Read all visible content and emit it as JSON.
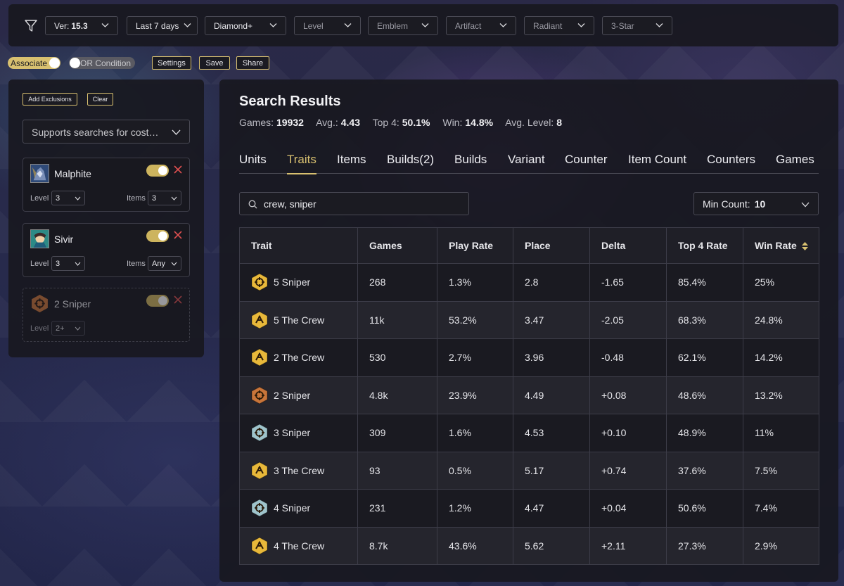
{
  "filters": {
    "version_prefix": "Ver:",
    "version": "15.3",
    "period": "Last 7 days",
    "rank": "Diamond+",
    "level": "Level",
    "emblem": "Emblem",
    "artifact": "Artifact",
    "radiant": "Radiant",
    "three_star": "3-Star"
  },
  "options": {
    "associate": "Associate",
    "or_condition": "OR Condition",
    "settings": "Settings",
    "save": "Save",
    "share": "Share"
  },
  "left": {
    "add_exclusions": "Add Exclusions",
    "clear": "Clear",
    "search_placeholder": "Supports searches for cost…",
    "cards": [
      {
        "name": "Malphite",
        "level_label": "Level",
        "level": "3",
        "items_label": "Items",
        "items": "3"
      },
      {
        "name": "Sivir",
        "level_label": "Level",
        "level": "3",
        "items_label": "Items",
        "items": "Any"
      },
      {
        "name": "2 Sniper",
        "level_label": "Level",
        "level": "2+"
      }
    ]
  },
  "main": {
    "title": "Search Results",
    "stats": {
      "games_label": "Games:",
      "games": "19932",
      "avg_label": "Avg.:",
      "avg": "4.43",
      "top4_label": "Top 4:",
      "top4": "50.1%",
      "win_label": "Win:",
      "win": "14.8%",
      "avg_level_label": "Avg. Level:",
      "avg_level": "8"
    },
    "tabs": [
      "Units",
      "Traits",
      "Items",
      "Builds(2)",
      "Builds",
      "Variant",
      "Counter",
      "Item Count",
      "Counters",
      "Games"
    ],
    "active_tab": "Traits",
    "search_value": "crew, sniper",
    "min_count_label": "Min Count:",
    "min_count": "10"
  },
  "table": {
    "headers": [
      "Trait",
      "Games",
      "Play Rate",
      "Place",
      "Delta",
      "Top 4 Rate",
      "Win Rate"
    ],
    "rows": [
      {
        "trait": "5 Sniper",
        "icon": "sniper-gold-icon",
        "tier": "gold",
        "games": "268",
        "play_rate": "1.3%",
        "place": "2.8",
        "delta": "-1.65",
        "top4": "85.4%",
        "win": "25%"
      },
      {
        "trait": "5 The Crew",
        "icon": "crew-gold-icon",
        "tier": "gold",
        "games": "11k",
        "play_rate": "53.2%",
        "place": "3.47",
        "delta": "-2.05",
        "top4": "68.3%",
        "win": "24.8%"
      },
      {
        "trait": "2 The Crew",
        "icon": "crew-gold-icon",
        "tier": "gold",
        "games": "530",
        "play_rate": "2.7%",
        "place": "3.96",
        "delta": "-0.48",
        "top4": "62.1%",
        "win": "14.2%"
      },
      {
        "trait": "2 Sniper",
        "icon": "sniper-bronze-icon",
        "tier": "bronze",
        "games": "4.8k",
        "play_rate": "23.9%",
        "place": "4.49",
        "delta": "+0.08",
        "top4": "48.6%",
        "win": "13.2%"
      },
      {
        "trait": "3 Sniper",
        "icon": "sniper-silver-icon",
        "tier": "silver",
        "games": "309",
        "play_rate": "1.6%",
        "place": "4.53",
        "delta": "+0.10",
        "top4": "48.9%",
        "win": "11%"
      },
      {
        "trait": "3 The Crew",
        "icon": "crew-gold-icon",
        "tier": "gold",
        "games": "93",
        "play_rate": "0.5%",
        "place": "5.17",
        "delta": "+0.74",
        "top4": "37.6%",
        "win": "7.5%"
      },
      {
        "trait": "4 Sniper",
        "icon": "sniper-silver-icon",
        "tier": "silver",
        "games": "231",
        "play_rate": "1.2%",
        "place": "4.47",
        "delta": "+0.04",
        "top4": "50.6%",
        "win": "7.4%"
      },
      {
        "trait": "4 The Crew",
        "icon": "crew-gold-icon",
        "tier": "gold",
        "games": "8.7k",
        "play_rate": "43.6%",
        "place": "5.62",
        "delta": "+2.11",
        "top4": "27.3%",
        "win": "2.9%"
      }
    ]
  },
  "colors": {
    "accent": "#d8c070",
    "gold": "#e8b83a",
    "bronze": "#c8753a",
    "silver": "#9fc4cc",
    "close": "#e05050"
  }
}
